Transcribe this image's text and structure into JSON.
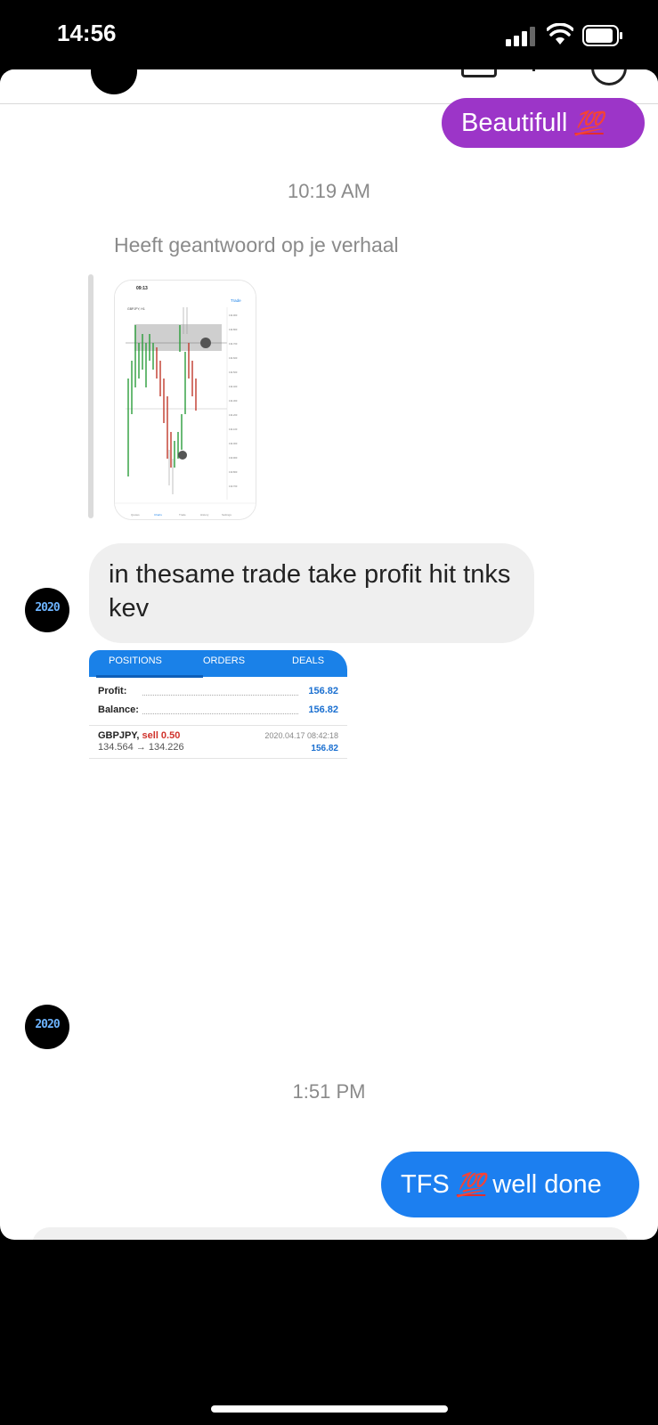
{
  "status_bar": {
    "time": "14:56"
  },
  "messages": {
    "sent_beautiful": {
      "text": "Beautifull",
      "emoji": "💯"
    },
    "timestamp_1": "10:19 AM",
    "story_reply_label": "Heeft geantwoord op je verhaal",
    "received_text": "in thesame trade take profit hit tnks kev",
    "avatar_label": "2020",
    "timestamp_2": "1:51 PM",
    "sent_well_done": {
      "prefix": "TFS",
      "emoji": "💯",
      "suffix": "well done"
    }
  },
  "story_chart": {
    "time": "09:13",
    "symbol": "GBPJPY, H1",
    "trade_label": "Trade",
    "nav_items": [
      "Quotes",
      "Charts",
      "Trade",
      "History",
      "Settings"
    ]
  },
  "trade_card": {
    "tabs": [
      "POSITIONS",
      "ORDERS",
      "DEALS"
    ],
    "profit_label": "Profit:",
    "profit_value": "156.82",
    "balance_label": "Balance:",
    "balance_value": "156.82",
    "symbol": "GBPJPY,",
    "side": "sell 0.50",
    "prices": "134.564 → 134.226",
    "datetime": "2020.04.17 08:42:18",
    "pnl": "156.82"
  },
  "colors": {
    "purple_bubble": "#9c35c8",
    "blue_bubble": "#1c7ff0",
    "gray_bubble": "#efefef",
    "mt_blue": "#1a81e8"
  }
}
